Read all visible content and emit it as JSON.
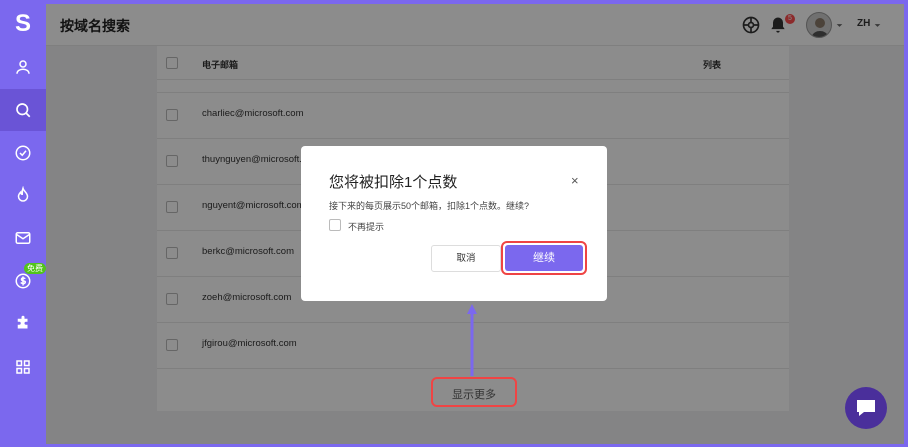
{
  "app": {
    "logo": "S",
    "page_title": "按域名搜索",
    "lang": "ZH",
    "notif_count": "5"
  },
  "sidebar": {
    "free_badge": "免费"
  },
  "table": {
    "headers": [
      "电子邮箱",
      "列表"
    ],
    "rows": [
      "charliec@microsoft.com",
      "thuynguyen@microsoft.com",
      "nguyent@microsoft.com",
      "berkc@microsoft.com",
      "zoeh@microsoft.com",
      "jfgirou@microsoft.com"
    ],
    "show_more": "显示更多"
  },
  "modal": {
    "title": "您将被扣除1个点数",
    "text": "接下来的每页展示50个邮箱，扣除1个点数。继续?",
    "checkbox_label": "不再提示",
    "cancel": "取消",
    "confirm": "继续",
    "close": "×"
  },
  "colors": {
    "accent": "#7b68ee",
    "highlight": "#ef4444"
  }
}
